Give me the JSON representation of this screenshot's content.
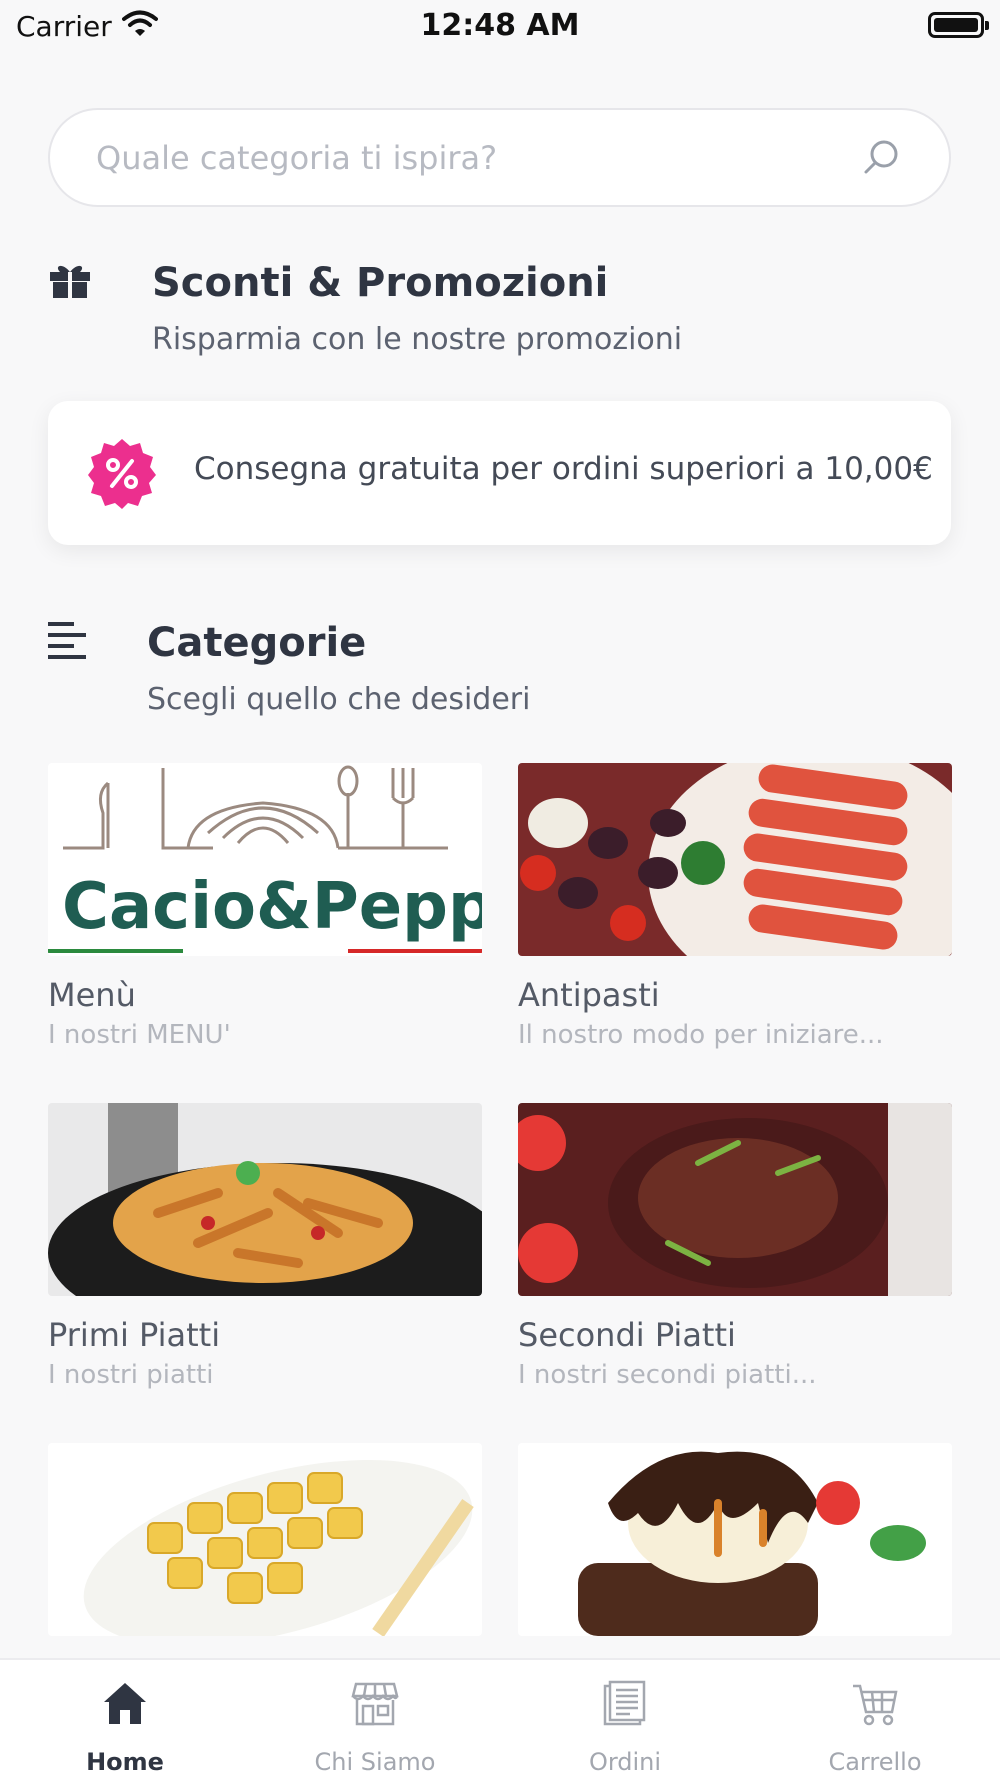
{
  "status_bar": {
    "carrier": "Carrier",
    "time": "12:48 AM"
  },
  "search": {
    "placeholder": "Quale categoria ti ispira?"
  },
  "promotions": {
    "title": "Sconti & Promozioni",
    "subtitle": "Risparmia con le nostre promozioni",
    "card_text": "Consegna gratuita per ordini superiori a 10,00€"
  },
  "categories": {
    "title": "Categorie",
    "subtitle": "Scegli quello che desideri",
    "items": [
      {
        "name": "Menù",
        "desc": "I nostri MENU'",
        "logo_text": "Cacio&Peppe"
      },
      {
        "name": "Antipasti",
        "desc": "Il nostro modo per iniziare..."
      },
      {
        "name": "Primi Piatti",
        "desc": "I nostri piatti"
      },
      {
        "name": "Secondi Piatti",
        "desc": "I nostri secondi piatti..."
      },
      {
        "name": "",
        "desc": ""
      },
      {
        "name": "",
        "desc": ""
      }
    ]
  },
  "tabbar": {
    "items": [
      {
        "label": "Home",
        "icon": "home-icon",
        "active": true
      },
      {
        "label": "Chi Siamo",
        "icon": "store-icon",
        "active": false
      },
      {
        "label": "Ordini",
        "icon": "orders-icon",
        "active": false
      },
      {
        "label": "Carrello",
        "icon": "cart-icon",
        "active": false
      }
    ]
  },
  "colors": {
    "accent": "#ec2f8e",
    "text_dark": "#2f3542",
    "muted": "#a3a7af"
  }
}
